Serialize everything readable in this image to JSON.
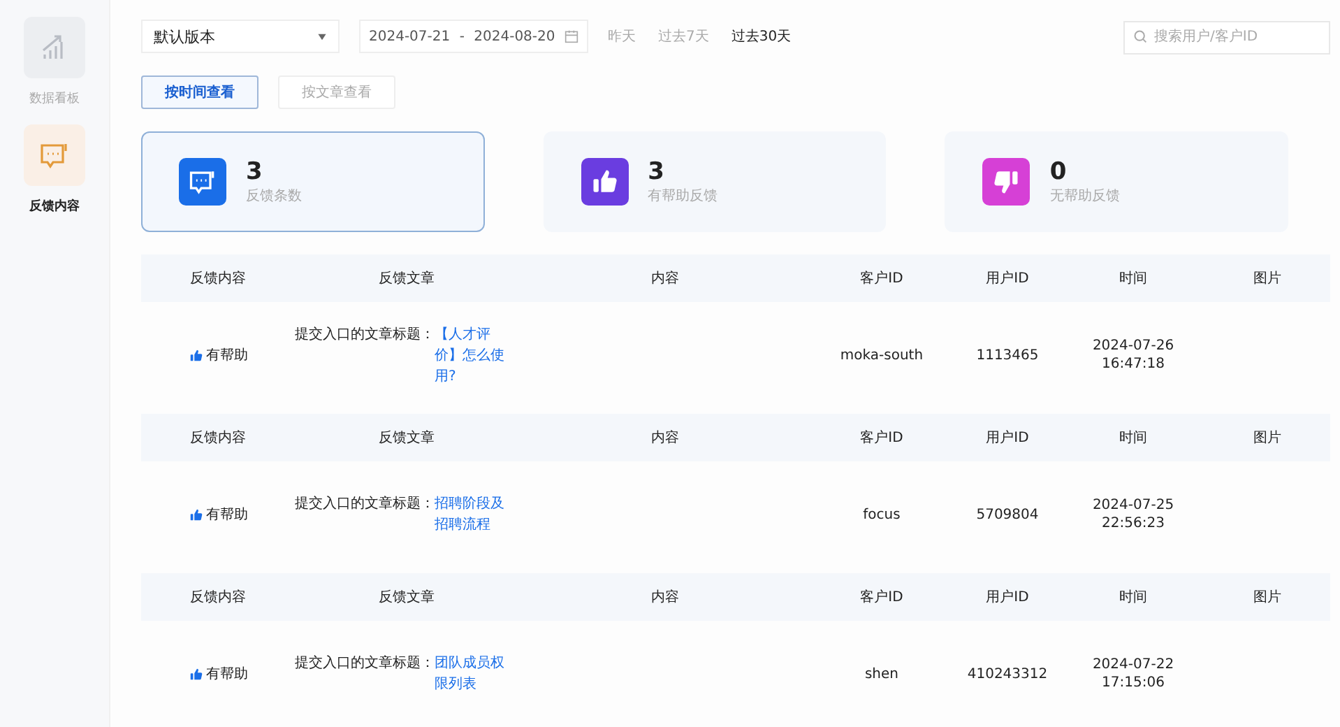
{
  "sidebar": {
    "items": [
      {
        "label": "数据看板",
        "kind": "chart",
        "selected": false
      },
      {
        "label": "反馈内容",
        "kind": "chat",
        "selected": true
      }
    ]
  },
  "filters": {
    "version_select": {
      "value": "默认版本"
    },
    "date_range": {
      "start": "2024-07-21",
      "separator": "-",
      "end": "2024-08-20"
    },
    "quick_ranges": [
      {
        "label": "昨天",
        "selected": false
      },
      {
        "label": "过去7天",
        "selected": false
      },
      {
        "label": "过去30天",
        "selected": true
      }
    ],
    "search": {
      "placeholder": "搜索用户/客户ID"
    }
  },
  "view_toggle": [
    {
      "label": "按时间查看",
      "selected": true
    },
    {
      "label": "按文章查看",
      "selected": false
    }
  ],
  "stats": [
    {
      "kind": "chat",
      "value": "3",
      "label": "反馈条数",
      "color": "#1a6ee8",
      "selected": true
    },
    {
      "kind": "like",
      "value": "3",
      "label": "有帮助反馈",
      "color": "#6a3de0",
      "selected": false
    },
    {
      "kind": "dislike",
      "value": "0",
      "label": "无帮助反馈",
      "color": "#d640d6",
      "selected": false
    }
  ],
  "records": [
    {
      "columns": [
        "反馈内容",
        "反馈文章",
        "内容",
        "客户ID",
        "用户ID",
        "时间",
        "图片"
      ],
      "feedback": "有帮助",
      "article_prefix": "提交入口的文章标题：",
      "article_title": "【人才评价】怎么使用?",
      "customer_id": "moka-south",
      "user_id": "1113465",
      "time": "2024-07-26 16:47:18"
    },
    {
      "columns": [
        "反馈内容",
        "反馈文章",
        "内容",
        "客户ID",
        "用户ID",
        "时间",
        "图片"
      ],
      "feedback": "有帮助",
      "article_prefix": "提交入口的文章标题：",
      "article_title": "招聘阶段及招聘流程",
      "customer_id": "focus",
      "user_id": "5709804",
      "time": "2024-07-25 22:56:23"
    },
    {
      "columns": [
        "反馈内容",
        "反馈文章",
        "内容",
        "客户ID",
        "用户ID",
        "时间",
        "图片"
      ],
      "feedback": "有帮助",
      "article_prefix": "提交入口的文章标题：",
      "article_title": "团队成员权限列表",
      "customer_id": "shen",
      "user_id": "410243312",
      "time": "2024-07-22 17:15:06"
    }
  ]
}
